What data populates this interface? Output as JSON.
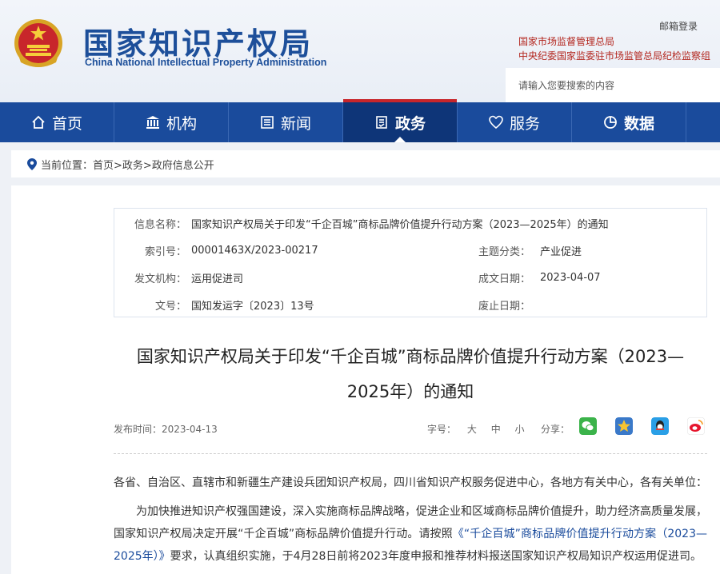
{
  "header": {
    "site_title": "国家知识产权局",
    "site_subtitle": "China National Intellectual Property Administration",
    "login_label": "邮箱登录",
    "org_links": [
      "国家市场监督管理总局",
      "中央纪委国家监委驻市场监管总局纪检监察组"
    ],
    "search_placeholder": "请输入您要搜索的内容"
  },
  "nav": {
    "items": [
      {
        "label": "首页",
        "icon": "home-icon"
      },
      {
        "label": "机构",
        "icon": "institution-icon"
      },
      {
        "label": "新闻",
        "icon": "news-icon"
      },
      {
        "label": "政务",
        "icon": "government-icon",
        "active": true
      },
      {
        "label": "服务",
        "icon": "service-icon"
      },
      {
        "label": "数据",
        "icon": "data-icon"
      }
    ]
  },
  "breadcrumb": {
    "prefix": "当前位置：",
    "path": "首页>政务>政府信息公开"
  },
  "meta": {
    "info_name_label": "信息名称：",
    "info_name_value": "国家知识产权局关于印发“千企百城”商标品牌价值提升行动方案（2023—2025年）的通知",
    "index_label": "索引号：",
    "index_value": "00001463X/2023-00217",
    "topic_label": "主题分类：",
    "topic_value": "产业促进",
    "issuer_label": "发文机构：",
    "issuer_value": "运用促进司",
    "date_label": "成文日期：",
    "date_value": "2023-04-07",
    "doc_no_label": "文号：",
    "doc_no_value": "国知发运字〔2023〕13号",
    "expiry_label": "废止日期：",
    "expiry_value": ""
  },
  "article": {
    "title_line1": "国家知识产权局关于印发“千企百城”商标品牌价值提升行动方案（2023—",
    "title_line2": "2025年）的通知",
    "publish_date": "发布时间：2023-04-13",
    "font_label": "字号：",
    "font_large": "大",
    "font_medium": "中",
    "font_small": "小",
    "share_label": "分享：",
    "para1": "各省、自治区、直辖市和新疆生产建设兵团知识产权局，四川省知识产权服务促进中心，各地方有关中心，各有关单位：",
    "para2_a": "为加快推进知识产权强国建设，深入实施商标品牌战略，促进企业和区域商标品牌价值提升，助力经济高质量发展，国家知识产权局决定开展“千企百城”商标品牌价值提升行动。请按照",
    "para2_link": "《“千企百城”商标品牌价值提升行动方案（2023—2025年）》",
    "para2_b": "要求，认真组织实施，于4月28日前将2023年度申报和推荐材料报送国家知识产权局知识产权运用促进司。"
  },
  "colors": {
    "nav_blue": "#1a4b9c",
    "nav_active": "#0e3578",
    "accent_red": "#c8262b",
    "title_blue": "#1d4f9a"
  }
}
